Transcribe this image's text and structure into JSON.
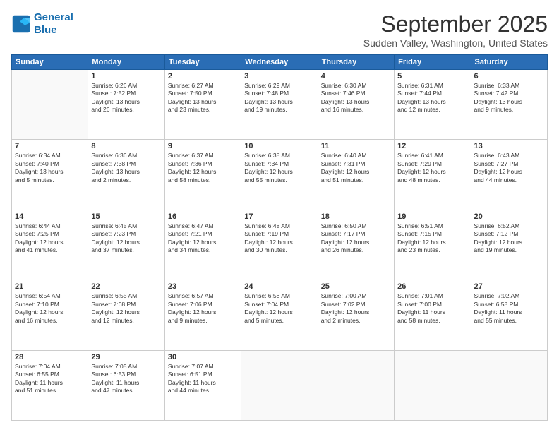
{
  "header": {
    "logo_line1": "General",
    "logo_line2": "Blue",
    "month": "September 2025",
    "location": "Sudden Valley, Washington, United States"
  },
  "weekdays": [
    "Sunday",
    "Monday",
    "Tuesday",
    "Wednesday",
    "Thursday",
    "Friday",
    "Saturday"
  ],
  "weeks": [
    [
      {
        "day": "",
        "info": ""
      },
      {
        "day": "1",
        "info": "Sunrise: 6:26 AM\nSunset: 7:52 PM\nDaylight: 13 hours\nand 26 minutes."
      },
      {
        "day": "2",
        "info": "Sunrise: 6:27 AM\nSunset: 7:50 PM\nDaylight: 13 hours\nand 23 minutes."
      },
      {
        "day": "3",
        "info": "Sunrise: 6:29 AM\nSunset: 7:48 PM\nDaylight: 13 hours\nand 19 minutes."
      },
      {
        "day": "4",
        "info": "Sunrise: 6:30 AM\nSunset: 7:46 PM\nDaylight: 13 hours\nand 16 minutes."
      },
      {
        "day": "5",
        "info": "Sunrise: 6:31 AM\nSunset: 7:44 PM\nDaylight: 13 hours\nand 12 minutes."
      },
      {
        "day": "6",
        "info": "Sunrise: 6:33 AM\nSunset: 7:42 PM\nDaylight: 13 hours\nand 9 minutes."
      }
    ],
    [
      {
        "day": "7",
        "info": "Sunrise: 6:34 AM\nSunset: 7:40 PM\nDaylight: 13 hours\nand 5 minutes."
      },
      {
        "day": "8",
        "info": "Sunrise: 6:36 AM\nSunset: 7:38 PM\nDaylight: 13 hours\nand 2 minutes."
      },
      {
        "day": "9",
        "info": "Sunrise: 6:37 AM\nSunset: 7:36 PM\nDaylight: 12 hours\nand 58 minutes."
      },
      {
        "day": "10",
        "info": "Sunrise: 6:38 AM\nSunset: 7:34 PM\nDaylight: 12 hours\nand 55 minutes."
      },
      {
        "day": "11",
        "info": "Sunrise: 6:40 AM\nSunset: 7:31 PM\nDaylight: 12 hours\nand 51 minutes."
      },
      {
        "day": "12",
        "info": "Sunrise: 6:41 AM\nSunset: 7:29 PM\nDaylight: 12 hours\nand 48 minutes."
      },
      {
        "day": "13",
        "info": "Sunrise: 6:43 AM\nSunset: 7:27 PM\nDaylight: 12 hours\nand 44 minutes."
      }
    ],
    [
      {
        "day": "14",
        "info": "Sunrise: 6:44 AM\nSunset: 7:25 PM\nDaylight: 12 hours\nand 41 minutes."
      },
      {
        "day": "15",
        "info": "Sunrise: 6:45 AM\nSunset: 7:23 PM\nDaylight: 12 hours\nand 37 minutes."
      },
      {
        "day": "16",
        "info": "Sunrise: 6:47 AM\nSunset: 7:21 PM\nDaylight: 12 hours\nand 34 minutes."
      },
      {
        "day": "17",
        "info": "Sunrise: 6:48 AM\nSunset: 7:19 PM\nDaylight: 12 hours\nand 30 minutes."
      },
      {
        "day": "18",
        "info": "Sunrise: 6:50 AM\nSunset: 7:17 PM\nDaylight: 12 hours\nand 26 minutes."
      },
      {
        "day": "19",
        "info": "Sunrise: 6:51 AM\nSunset: 7:15 PM\nDaylight: 12 hours\nand 23 minutes."
      },
      {
        "day": "20",
        "info": "Sunrise: 6:52 AM\nSunset: 7:12 PM\nDaylight: 12 hours\nand 19 minutes."
      }
    ],
    [
      {
        "day": "21",
        "info": "Sunrise: 6:54 AM\nSunset: 7:10 PM\nDaylight: 12 hours\nand 16 minutes."
      },
      {
        "day": "22",
        "info": "Sunrise: 6:55 AM\nSunset: 7:08 PM\nDaylight: 12 hours\nand 12 minutes."
      },
      {
        "day": "23",
        "info": "Sunrise: 6:57 AM\nSunset: 7:06 PM\nDaylight: 12 hours\nand 9 minutes."
      },
      {
        "day": "24",
        "info": "Sunrise: 6:58 AM\nSunset: 7:04 PM\nDaylight: 12 hours\nand 5 minutes."
      },
      {
        "day": "25",
        "info": "Sunrise: 7:00 AM\nSunset: 7:02 PM\nDaylight: 12 hours\nand 2 minutes."
      },
      {
        "day": "26",
        "info": "Sunrise: 7:01 AM\nSunset: 7:00 PM\nDaylight: 11 hours\nand 58 minutes."
      },
      {
        "day": "27",
        "info": "Sunrise: 7:02 AM\nSunset: 6:58 PM\nDaylight: 11 hours\nand 55 minutes."
      }
    ],
    [
      {
        "day": "28",
        "info": "Sunrise: 7:04 AM\nSunset: 6:55 PM\nDaylight: 11 hours\nand 51 minutes."
      },
      {
        "day": "29",
        "info": "Sunrise: 7:05 AM\nSunset: 6:53 PM\nDaylight: 11 hours\nand 47 minutes."
      },
      {
        "day": "30",
        "info": "Sunrise: 7:07 AM\nSunset: 6:51 PM\nDaylight: 11 hours\nand 44 minutes."
      },
      {
        "day": "",
        "info": ""
      },
      {
        "day": "",
        "info": ""
      },
      {
        "day": "",
        "info": ""
      },
      {
        "day": "",
        "info": ""
      }
    ]
  ]
}
